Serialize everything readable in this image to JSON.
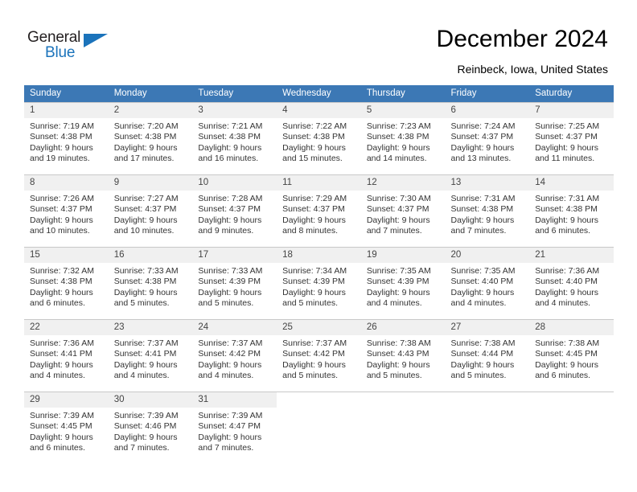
{
  "brand": {
    "name_top": "General",
    "name_bottom": "Blue",
    "color_dark": "#231f20",
    "color_blue": "#1b73bb"
  },
  "header": {
    "title": "December 2024",
    "subtitle": "Reinbeck, Iowa, United States",
    "header_bg": "#3c78b5",
    "header_text_color": "#ffffff"
  },
  "weekdays": [
    "Sunday",
    "Monday",
    "Tuesday",
    "Wednesday",
    "Thursday",
    "Friday",
    "Saturday"
  ],
  "labels": {
    "sunrise_prefix": "Sunrise:",
    "sunset_prefix": "Sunset:",
    "daylight_prefix": "Daylight:"
  },
  "weeks": [
    [
      {
        "day": "1",
        "sunrise": "Sunrise: 7:19 AM",
        "sunset": "Sunset: 4:38 PM",
        "daylight_line1": "Daylight: 9 hours",
        "daylight_line2": "and 19 minutes."
      },
      {
        "day": "2",
        "sunrise": "Sunrise: 7:20 AM",
        "sunset": "Sunset: 4:38 PM",
        "daylight_line1": "Daylight: 9 hours",
        "daylight_line2": "and 17 minutes."
      },
      {
        "day": "3",
        "sunrise": "Sunrise: 7:21 AM",
        "sunset": "Sunset: 4:38 PM",
        "daylight_line1": "Daylight: 9 hours",
        "daylight_line2": "and 16 minutes."
      },
      {
        "day": "4",
        "sunrise": "Sunrise: 7:22 AM",
        "sunset": "Sunset: 4:38 PM",
        "daylight_line1": "Daylight: 9 hours",
        "daylight_line2": "and 15 minutes."
      },
      {
        "day": "5",
        "sunrise": "Sunrise: 7:23 AM",
        "sunset": "Sunset: 4:38 PM",
        "daylight_line1": "Daylight: 9 hours",
        "daylight_line2": "and 14 minutes."
      },
      {
        "day": "6",
        "sunrise": "Sunrise: 7:24 AM",
        "sunset": "Sunset: 4:37 PM",
        "daylight_line1": "Daylight: 9 hours",
        "daylight_line2": "and 13 minutes."
      },
      {
        "day": "7",
        "sunrise": "Sunrise: 7:25 AM",
        "sunset": "Sunset: 4:37 PM",
        "daylight_line1": "Daylight: 9 hours",
        "daylight_line2": "and 11 minutes."
      }
    ],
    [
      {
        "day": "8",
        "sunrise": "Sunrise: 7:26 AM",
        "sunset": "Sunset: 4:37 PM",
        "daylight_line1": "Daylight: 9 hours",
        "daylight_line2": "and 10 minutes."
      },
      {
        "day": "9",
        "sunrise": "Sunrise: 7:27 AM",
        "sunset": "Sunset: 4:37 PM",
        "daylight_line1": "Daylight: 9 hours",
        "daylight_line2": "and 10 minutes."
      },
      {
        "day": "10",
        "sunrise": "Sunrise: 7:28 AM",
        "sunset": "Sunset: 4:37 PM",
        "daylight_line1": "Daylight: 9 hours",
        "daylight_line2": "and 9 minutes."
      },
      {
        "day": "11",
        "sunrise": "Sunrise: 7:29 AM",
        "sunset": "Sunset: 4:37 PM",
        "daylight_line1": "Daylight: 9 hours",
        "daylight_line2": "and 8 minutes."
      },
      {
        "day": "12",
        "sunrise": "Sunrise: 7:30 AM",
        "sunset": "Sunset: 4:37 PM",
        "daylight_line1": "Daylight: 9 hours",
        "daylight_line2": "and 7 minutes."
      },
      {
        "day": "13",
        "sunrise": "Sunrise: 7:31 AM",
        "sunset": "Sunset: 4:38 PM",
        "daylight_line1": "Daylight: 9 hours",
        "daylight_line2": "and 7 minutes."
      },
      {
        "day": "14",
        "sunrise": "Sunrise: 7:31 AM",
        "sunset": "Sunset: 4:38 PM",
        "daylight_line1": "Daylight: 9 hours",
        "daylight_line2": "and 6 minutes."
      }
    ],
    [
      {
        "day": "15",
        "sunrise": "Sunrise: 7:32 AM",
        "sunset": "Sunset: 4:38 PM",
        "daylight_line1": "Daylight: 9 hours",
        "daylight_line2": "and 6 minutes."
      },
      {
        "day": "16",
        "sunrise": "Sunrise: 7:33 AM",
        "sunset": "Sunset: 4:38 PM",
        "daylight_line1": "Daylight: 9 hours",
        "daylight_line2": "and 5 minutes."
      },
      {
        "day": "17",
        "sunrise": "Sunrise: 7:33 AM",
        "sunset": "Sunset: 4:39 PM",
        "daylight_line1": "Daylight: 9 hours",
        "daylight_line2": "and 5 minutes."
      },
      {
        "day": "18",
        "sunrise": "Sunrise: 7:34 AM",
        "sunset": "Sunset: 4:39 PM",
        "daylight_line1": "Daylight: 9 hours",
        "daylight_line2": "and 5 minutes."
      },
      {
        "day": "19",
        "sunrise": "Sunrise: 7:35 AM",
        "sunset": "Sunset: 4:39 PM",
        "daylight_line1": "Daylight: 9 hours",
        "daylight_line2": "and 4 minutes."
      },
      {
        "day": "20",
        "sunrise": "Sunrise: 7:35 AM",
        "sunset": "Sunset: 4:40 PM",
        "daylight_line1": "Daylight: 9 hours",
        "daylight_line2": "and 4 minutes."
      },
      {
        "day": "21",
        "sunrise": "Sunrise: 7:36 AM",
        "sunset": "Sunset: 4:40 PM",
        "daylight_line1": "Daylight: 9 hours",
        "daylight_line2": "and 4 minutes."
      }
    ],
    [
      {
        "day": "22",
        "sunrise": "Sunrise: 7:36 AM",
        "sunset": "Sunset: 4:41 PM",
        "daylight_line1": "Daylight: 9 hours",
        "daylight_line2": "and 4 minutes."
      },
      {
        "day": "23",
        "sunrise": "Sunrise: 7:37 AM",
        "sunset": "Sunset: 4:41 PM",
        "daylight_line1": "Daylight: 9 hours",
        "daylight_line2": "and 4 minutes."
      },
      {
        "day": "24",
        "sunrise": "Sunrise: 7:37 AM",
        "sunset": "Sunset: 4:42 PM",
        "daylight_line1": "Daylight: 9 hours",
        "daylight_line2": "and 4 minutes."
      },
      {
        "day": "25",
        "sunrise": "Sunrise: 7:37 AM",
        "sunset": "Sunset: 4:42 PM",
        "daylight_line1": "Daylight: 9 hours",
        "daylight_line2": "and 5 minutes."
      },
      {
        "day": "26",
        "sunrise": "Sunrise: 7:38 AM",
        "sunset": "Sunset: 4:43 PM",
        "daylight_line1": "Daylight: 9 hours",
        "daylight_line2": "and 5 minutes."
      },
      {
        "day": "27",
        "sunrise": "Sunrise: 7:38 AM",
        "sunset": "Sunset: 4:44 PM",
        "daylight_line1": "Daylight: 9 hours",
        "daylight_line2": "and 5 minutes."
      },
      {
        "day": "28",
        "sunrise": "Sunrise: 7:38 AM",
        "sunset": "Sunset: 4:45 PM",
        "daylight_line1": "Daylight: 9 hours",
        "daylight_line2": "and 6 minutes."
      }
    ],
    [
      {
        "day": "29",
        "sunrise": "Sunrise: 7:39 AM",
        "sunset": "Sunset: 4:45 PM",
        "daylight_line1": "Daylight: 9 hours",
        "daylight_line2": "and 6 minutes."
      },
      {
        "day": "30",
        "sunrise": "Sunrise: 7:39 AM",
        "sunset": "Sunset: 4:46 PM",
        "daylight_line1": "Daylight: 9 hours",
        "daylight_line2": "and 7 minutes."
      },
      {
        "day": "31",
        "sunrise": "Sunrise: 7:39 AM",
        "sunset": "Sunset: 4:47 PM",
        "daylight_line1": "Daylight: 9 hours",
        "daylight_line2": "and 7 minutes."
      },
      {
        "day": "",
        "sunrise": "",
        "sunset": "",
        "daylight_line1": "",
        "daylight_line2": ""
      },
      {
        "day": "",
        "sunrise": "",
        "sunset": "",
        "daylight_line1": "",
        "daylight_line2": ""
      },
      {
        "day": "",
        "sunrise": "",
        "sunset": "",
        "daylight_line1": "",
        "daylight_line2": ""
      },
      {
        "day": "",
        "sunrise": "",
        "sunset": "",
        "daylight_line1": "",
        "daylight_line2": ""
      }
    ]
  ]
}
